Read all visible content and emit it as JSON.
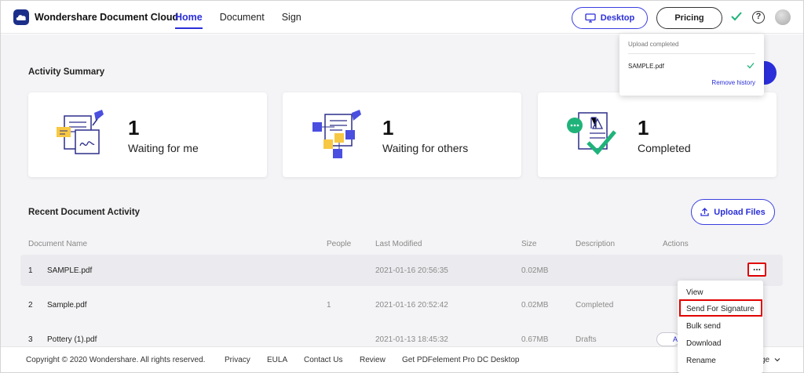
{
  "app": {
    "name": "Wondershare Document Cloud"
  },
  "nav": [
    {
      "label": "Home",
      "active": true
    },
    {
      "label": "Document",
      "active": false
    },
    {
      "label": "Sign",
      "active": false
    }
  ],
  "header": {
    "desktop_label": "Desktop",
    "pricing_label": "Pricing"
  },
  "upload_popup": {
    "title": "Upload completed",
    "file": "SAMPLE.pdf",
    "remove_label": "Remove history"
  },
  "activity": {
    "title": "Activity Summary",
    "cards": [
      {
        "count": "1",
        "label": "Waiting for me",
        "icon": "signing-document-icon"
      },
      {
        "count": "1",
        "label": "Waiting for others",
        "icon": "shared-documents-icon"
      },
      {
        "count": "1",
        "label": "Completed",
        "icon": "completed-document-icon"
      }
    ]
  },
  "recent": {
    "title": "Recent Document Activity",
    "upload_label": "Upload Files",
    "columns": [
      "Document Name",
      "People",
      "Last Modified",
      "Size",
      "Description",
      "Actions"
    ],
    "rows": [
      {
        "index": "1",
        "name": "SAMPLE.pdf",
        "people": "",
        "modified": "2021-01-16 20:56:35",
        "size": "0.02MB",
        "description": ""
      },
      {
        "index": "2",
        "name": "Sample.pdf",
        "people": "1",
        "modified": "2021-01-16 20:52:42",
        "size": "0.02MB",
        "description": "Completed"
      },
      {
        "index": "3",
        "name": "Pottery (1).pdf",
        "people": "",
        "modified": "2021-01-13 18:45:32",
        "size": "0.67MB",
        "description": "Drafts"
      }
    ],
    "actions_label": "...",
    "row3_action_stub": "A"
  },
  "action_menu": [
    "View",
    "Send For Signature",
    "Bulk send",
    "Download",
    "Rename"
  ],
  "footer": {
    "copyright": "Copyright © 2020 Wondershare. All rights reserved.",
    "links": [
      "Privacy",
      "EULA",
      "Contact Us",
      "Review",
      "Get PDFelement Pro DC Desktop"
    ],
    "language_stub": "ge"
  },
  "colors": {
    "accent": "#2b2fd9",
    "highlight_red": "#e00000",
    "success": "#1fb37a"
  }
}
